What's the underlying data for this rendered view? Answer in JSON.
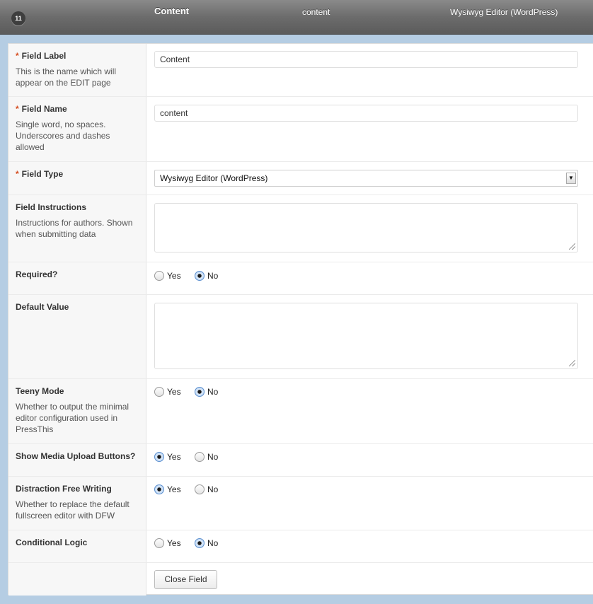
{
  "header": {
    "order": "11",
    "label": "Content",
    "name": "content",
    "type": "Wysiwyg Editor (WordPress)"
  },
  "fields": {
    "field_label": {
      "label": "Field Label",
      "required_mark": "*",
      "description": "This is the name which will appear on the EDIT page",
      "value": "Content"
    },
    "field_name": {
      "label": "Field Name",
      "required_mark": "*",
      "description": "Single word, no spaces. Underscores and dashes allowed",
      "value": "content"
    },
    "field_type": {
      "label": "Field Type",
      "required_mark": "*",
      "selected": "Wysiwyg Editor (WordPress)"
    },
    "field_instructions": {
      "label": "Field Instructions",
      "description": "Instructions for authors. Shown when submitting data",
      "value": ""
    },
    "required": {
      "label": "Required?",
      "yes": "Yes",
      "no": "No",
      "selected": "No"
    },
    "default_value": {
      "label": "Default Value",
      "value": ""
    },
    "teeny_mode": {
      "label": "Teeny Mode",
      "description": "Whether to output the minimal editor configuration used in PressThis",
      "yes": "Yes",
      "no": "No",
      "selected": "No"
    },
    "media_upload": {
      "label": "Show Media Upload Buttons?",
      "yes": "Yes",
      "no": "No",
      "selected": "Yes"
    },
    "distraction_free": {
      "label": "Distraction Free Writing",
      "description": "Whether to replace the default fullscreen editor with DFW",
      "yes": "Yes",
      "no": "No",
      "selected": "Yes"
    },
    "conditional_logic": {
      "label": "Conditional Logic",
      "yes": "Yes",
      "no": "No",
      "selected": "No"
    }
  },
  "footer": {
    "close_label": "Close Field"
  },
  "icons": {
    "select_arrow": "chevron-down-icon",
    "resize": "resize-grip-icon"
  }
}
